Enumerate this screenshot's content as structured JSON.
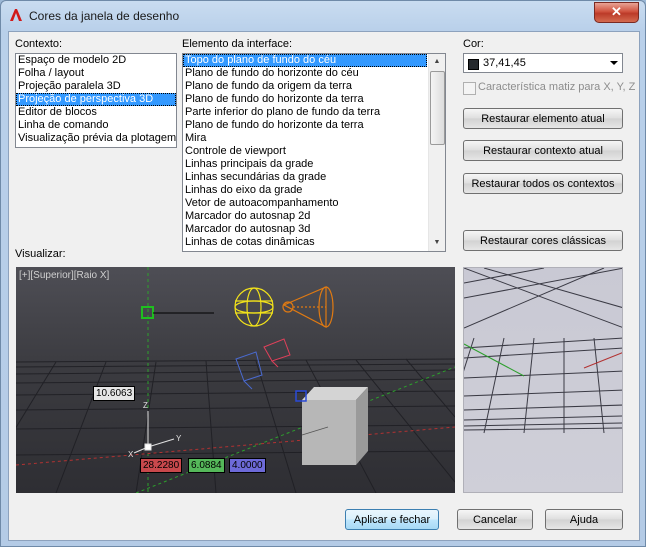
{
  "window": {
    "title": "Cores da janela de desenho",
    "close_glyph": "✕"
  },
  "context": {
    "label": "Contexto:",
    "items": [
      {
        "label": "Espaço de modelo 2D"
      },
      {
        "label": "Folha / layout"
      },
      {
        "label": "Projeção paralela 3D"
      },
      {
        "label": "Projeção de perspectiva 3D",
        "selected": true
      },
      {
        "label": "Editor de blocos"
      },
      {
        "label": "Linha de comando"
      },
      {
        "label": "Visualização prévia da plotagem"
      }
    ]
  },
  "interface_element": {
    "label": "Elemento da interface:",
    "items": [
      {
        "label": "Topo do plano de fundo do céu",
        "selected": true
      },
      {
        "label": "Plano de fundo do horizonte do céu"
      },
      {
        "label": "Plano de fundo da origem da terra"
      },
      {
        "label": "Plano de fundo do horizonte da terra"
      },
      {
        "label": "Parte inferior do plano de fundo da terra"
      },
      {
        "label": "Plano de fundo do horizonte da terra"
      },
      {
        "label": "Mira"
      },
      {
        "label": "Controle de viewport"
      },
      {
        "label": "Linhas principais da grade"
      },
      {
        "label": "Linhas secundárias da grade"
      },
      {
        "label": "Linhas do eixo da grade"
      },
      {
        "label": "Vetor de autoacompanhamento"
      },
      {
        "label": "Marcador do autosnap 2d"
      },
      {
        "label": "Marcador do autosnap 3d"
      },
      {
        "label": "Linhas de cotas dinâmicas"
      }
    ]
  },
  "color": {
    "label": "Cor:",
    "value": "37,41,45",
    "swatch": "#25292d",
    "tint_checkbox_label": "Característica matiz para X, Y, Z",
    "tint_checked": false
  },
  "buttons": {
    "restore_element": "Restaurar elemento atual",
    "restore_context": "Restaurar contexto atual",
    "restore_all": "Restaurar todos os contextos",
    "restore_classic": "Restaurar cores clássicas",
    "apply_close": "Aplicar e fechar",
    "cancel": "Cancelar",
    "help": "Ajuda"
  },
  "preview": {
    "label": "Visualizar:",
    "viewport_label": "[+][Superior][Raio X]",
    "dim_distance": "10.6063",
    "dim_x": "28.2280",
    "dim_y": "6.0884",
    "dim_z": "4.0000",
    "axis_z": "Z",
    "axis_y": "Y",
    "axis_x": "X",
    "colors": {
      "dim_x_bg": "#c8484c",
      "dim_y_bg": "#55b85a",
      "dim_z_bg": "#6d6ad8"
    }
  }
}
